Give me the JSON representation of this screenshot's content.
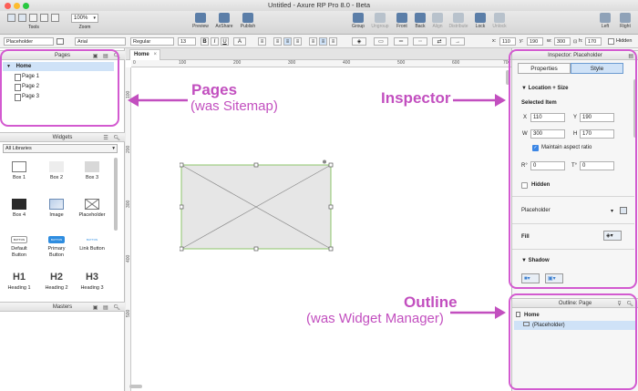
{
  "window": {
    "title": "Untitled - Axure RP Pro 8.0 - Beta"
  },
  "toolbar": {
    "tools_label": "Tools",
    "zoom_value": "100%",
    "zoom_label": "Zoom",
    "preview": "Preview",
    "axshare": "AxShare",
    "publish": "Publish",
    "group": "Group",
    "ungroup": "Ungroup",
    "front": "Front",
    "back": "Back",
    "align": "Align",
    "distribute": "Distribute",
    "lock": "Lock",
    "unlock": "Unlock",
    "left": "Left",
    "right": "Right"
  },
  "format": {
    "widget_style": "Placeholder",
    "font_family": "Arial",
    "font_weight": "Regular",
    "font_size": "13",
    "bold": "B",
    "italic": "I",
    "underline": "U",
    "x_label": "x:",
    "x": "110",
    "y_label": "y:",
    "y": "190",
    "w_label": "w:",
    "w": "300",
    "h_label": "h:",
    "h": "170",
    "hidden": "Hidden"
  },
  "pages_panel": {
    "title": "Pages",
    "home": "Home",
    "pages": [
      "Page 1",
      "Page 2",
      "Page 3"
    ]
  },
  "widgets_panel": {
    "title": "Widgets",
    "library": "All Libraries",
    "items": [
      {
        "label": "Box 1",
        "icon": "box1"
      },
      {
        "label": "Box 2",
        "icon": "box2"
      },
      {
        "label": "Box 3",
        "icon": "box3"
      },
      {
        "label": "Box 4",
        "icon": "box4"
      },
      {
        "label": "Image",
        "icon": "image"
      },
      {
        "label": "Placeholder",
        "icon": "placeholder"
      },
      {
        "label": "Default Button",
        "icon": "default-button",
        "glyph": "BUTTON"
      },
      {
        "label": "Primary Button",
        "icon": "primary-button",
        "glyph": "BUTTON"
      },
      {
        "label": "Link Button",
        "icon": "link-button",
        "glyph": "BUTTON"
      },
      {
        "label": "Heading 1",
        "icon": "h1",
        "glyph": "H1"
      },
      {
        "label": "Heading 2",
        "icon": "h2",
        "glyph": "H2"
      },
      {
        "label": "Heading 3",
        "icon": "h3",
        "glyph": "H3"
      }
    ]
  },
  "masters_panel": {
    "title": "Masters"
  },
  "canvas": {
    "tab": "Home",
    "ruler_h": [
      "0",
      "100",
      "200",
      "300",
      "400",
      "500",
      "600",
      "700"
    ],
    "ruler_v": [
      "100",
      "200",
      "300",
      "400",
      "500"
    ]
  },
  "inspector": {
    "header": "Inspector: Placeholder",
    "tab_properties": "Properties",
    "tab_style": "Style",
    "section_location": "Location + Size",
    "selected_item": "Selected Item",
    "x_label": "X",
    "x": "110",
    "y_label": "Y",
    "y": "190",
    "w_label": "W",
    "w": "300",
    "h_label": "H",
    "h": "170",
    "aspect": "Maintain aspect ratio",
    "rotate_label": "R°",
    "rotate": "0",
    "text_rotate_label": "T°",
    "text_rotate": "0",
    "hidden": "Hidden",
    "style_value": "Placeholder",
    "fill": "Fill",
    "shadow": "Shadow"
  },
  "outline_panel": {
    "title": "Outline: Page",
    "home": "Home",
    "item": "(Placeholder)"
  },
  "callouts": {
    "pages_title": "Pages",
    "pages_sub": "(was Sitemap)",
    "inspector": "Inspector",
    "outline_title": "Outline",
    "outline_sub": "(was Widget Manager)"
  },
  "colors": {
    "callout": "#c24fbf",
    "accent": "#5b7ea8",
    "selection": "#cfe2f7"
  }
}
